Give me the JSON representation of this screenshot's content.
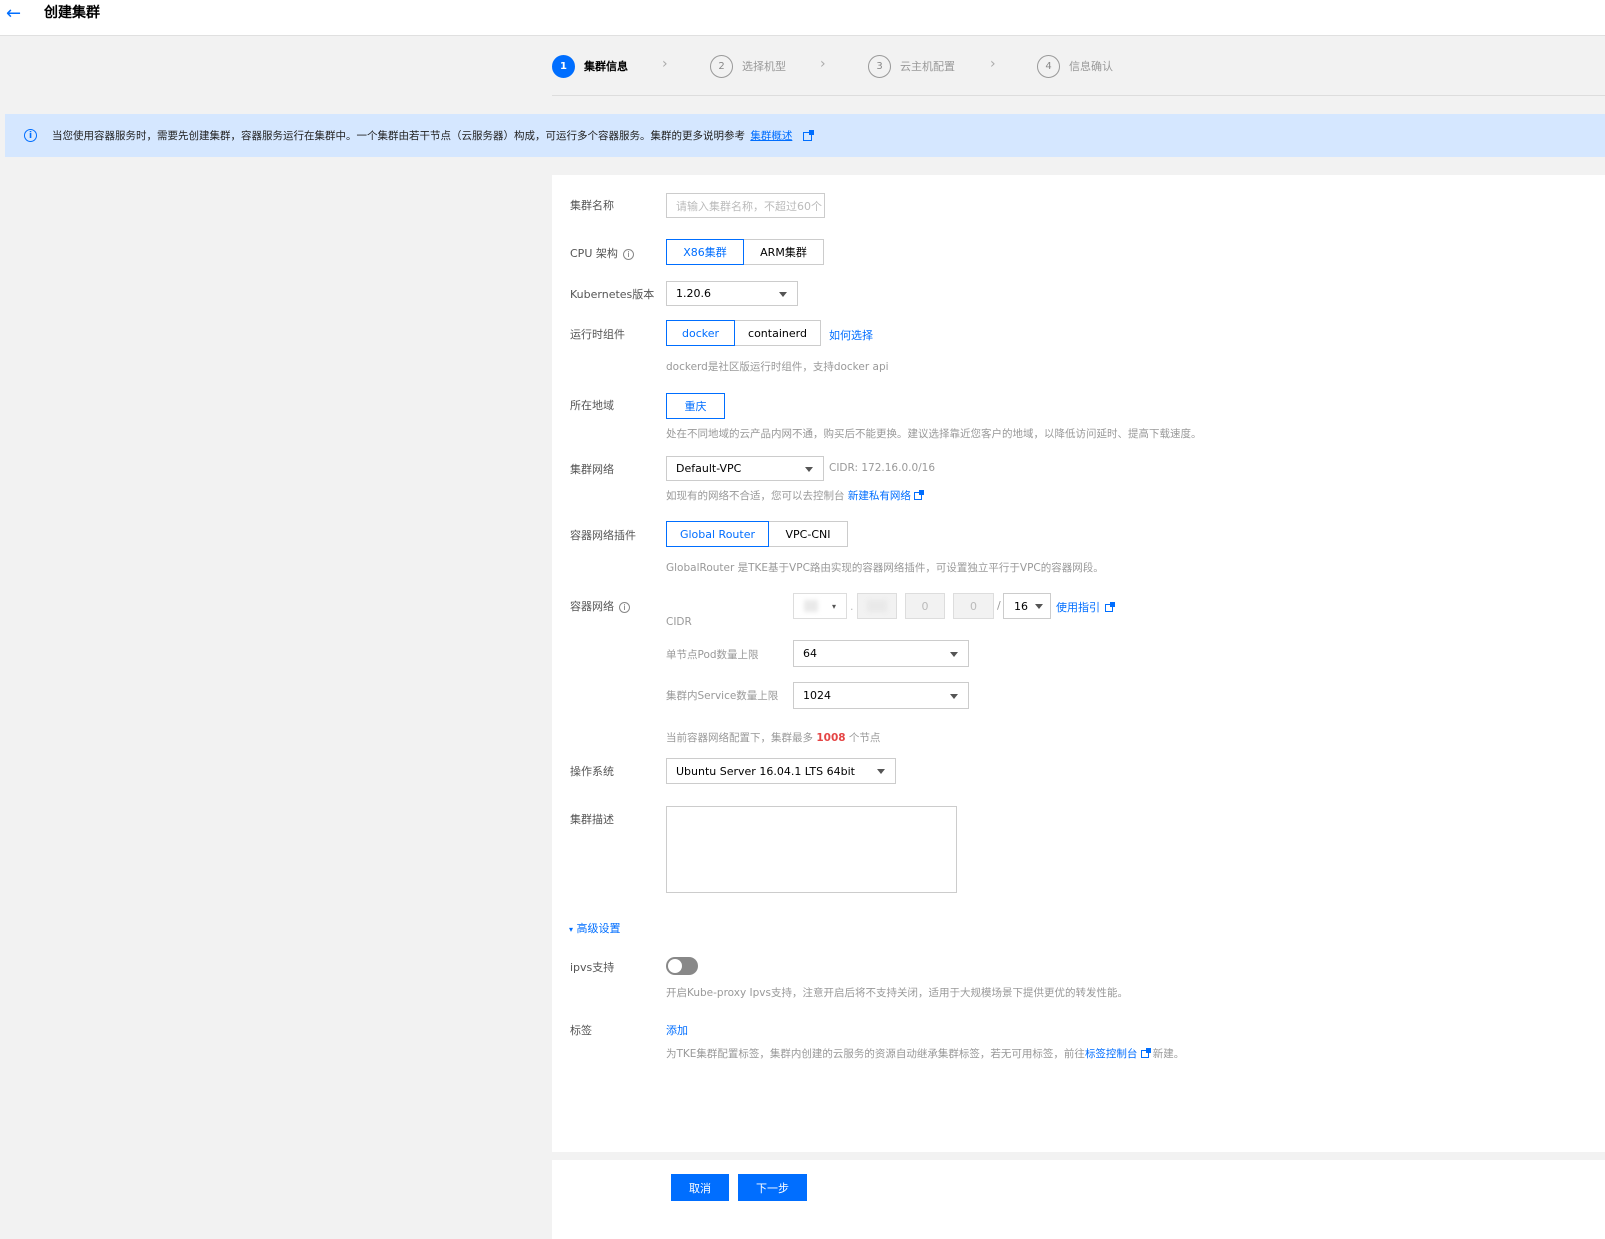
{
  "header": {
    "title": "创建集群",
    "back_icon": "arrow-left-icon"
  },
  "steps": [
    {
      "num": "1",
      "label": "集群信息",
      "active": true
    },
    {
      "num": "2",
      "label": "选择机型",
      "active": false
    },
    {
      "num": "3",
      "label": "云主机配置",
      "active": false
    },
    {
      "num": "4",
      "label": "信息确认",
      "active": false
    }
  ],
  "info": {
    "text": "当您使用容器服务时，需要先创建集群，容器服务运行在集群中。一个集群由若干节点（云服务器）构成，可运行多个容器服务。集群的更多说明参考",
    "link": "集群概述"
  },
  "form": {
    "name": {
      "label": "集群名称",
      "placeholder": "请输入集群名称，不超过60个"
    },
    "cpu": {
      "label": "CPU 架构",
      "options": [
        "X86集群",
        "ARM集群"
      ],
      "selected": "X86集群"
    },
    "k8s": {
      "label": "Kubernetes版本",
      "value": "1.20.6"
    },
    "runtime": {
      "label": "运行时组件",
      "options": [
        "docker",
        "containerd"
      ],
      "selected": "docker",
      "help_link": "如何选择",
      "hint": "dockerd是社区版运行时组件，支持docker api"
    },
    "region": {
      "label": "所在地域",
      "value": "重庆",
      "hint": "处在不同地域的云产品内网不通，购买后不能更换。建议选择靠近您客户的地域，以降低访问延时、提高下载速度。"
    },
    "network": {
      "label": "集群网络",
      "value": "Default-VPC",
      "cidr": "CIDR: 172.16.0.0/16",
      "hint": "如现有的网络不合适，您可以去控制台",
      "link": "新建私有网络"
    },
    "plugin": {
      "label": "容器网络插件",
      "options": [
        "Global Router",
        "VPC-CNI"
      ],
      "selected": "Global Router",
      "hint": "GlobalRouter 是TKE基于VPC路由实现的容器网络插件，可设置独立平行于VPC的容器网段。"
    },
    "container_net": {
      "label": "容器网络",
      "cidr_label": "CIDR",
      "oct3": "0",
      "oct4": "0",
      "slash": "/",
      "mask": "16",
      "guide_link": "使用指引",
      "pod_label": "单节点Pod数量上限",
      "pod_value": "64",
      "svc_label": "集群内Service数量上限",
      "svc_value": "1024",
      "summary_pre": "当前容器网络配置下，集群最多",
      "summary_num": "1008",
      "summary_post": "个节点"
    },
    "os": {
      "label": "操作系统",
      "value": "Ubuntu Server 16.04.1 LTS 64bit"
    },
    "desc": {
      "label": "集群描述"
    },
    "advanced": "高级设置",
    "ipvs": {
      "label": "ipvs支持",
      "on": false,
      "hint": "开启Kube-proxy Ipvs支持，注意开启后将不支持关闭，适用于大规模场景下提供更优的转发性能。"
    },
    "tags": {
      "label": "标签",
      "add": "添加",
      "hint_pre": "为TKE集群配置标签，集群内创建的云服务的资源自动继承集群标签，若无可用标签，前往",
      "hint_link": "标签控制台",
      "hint_post": "新建。"
    }
  },
  "footer": {
    "cancel": "取消",
    "next": "下一步"
  },
  "colors": {
    "primary": "#006eff",
    "info_bg": "#d5e7ff",
    "highlight": "#e54545"
  }
}
